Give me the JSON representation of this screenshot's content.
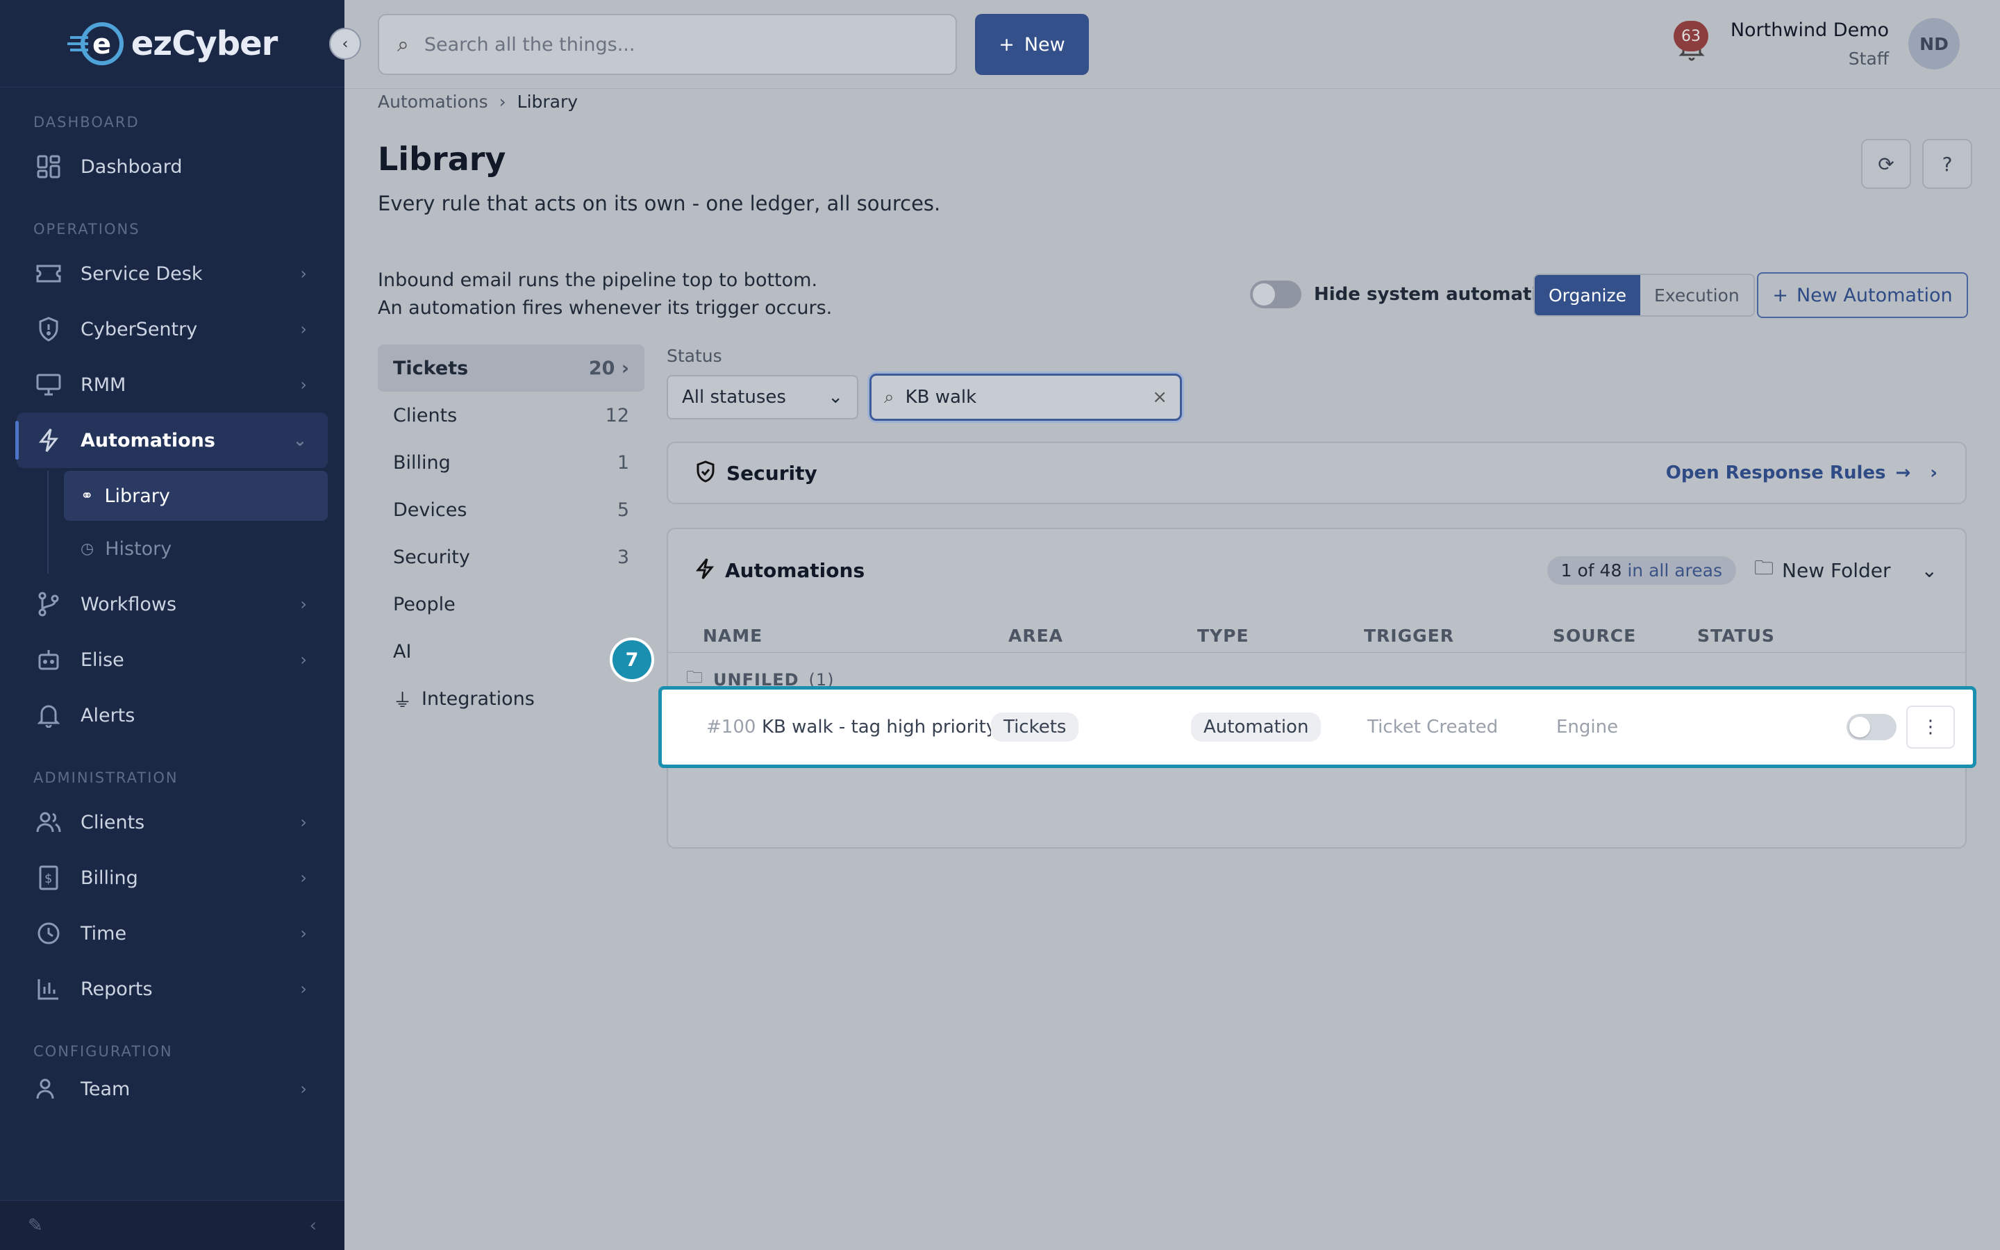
{
  "brand": {
    "name": "ezCyber"
  },
  "sidebar": {
    "sections": {
      "dashboard": "DASHBOARD",
      "operations": "OPERATIONS",
      "administration": "ADMINISTRATION",
      "configuration": "CONFIGURATION"
    },
    "items": {
      "dashboard": "Dashboard",
      "service_desk": "Service Desk",
      "cybersentry": "CyberSentry",
      "rmm": "RMM",
      "automations": "Automations",
      "library": "Library",
      "history": "History",
      "workflows": "Workflows",
      "elise": "Elise",
      "alerts": "Alerts",
      "clients": "Clients",
      "billing": "Billing",
      "time": "Time",
      "reports": "Reports",
      "team": "Team"
    }
  },
  "topbar": {
    "search_placeholder": "Search all the things...",
    "new_label": "New",
    "notification_count": "63",
    "user_name": "Northwind Demo",
    "user_role": "Staff",
    "avatar_initials": "ND"
  },
  "breadcrumb": {
    "parent": "Automations",
    "current": "Library"
  },
  "page": {
    "title": "Library",
    "subtitle": "Every rule that acts on its own - one ledger, all sources.",
    "intro_line1": "Inbound email runs the pipeline top to bottom.",
    "intro_line2": "An automation fires whenever its trigger occurs."
  },
  "controls": {
    "hide_system_label": "Hide system automations",
    "hide_system_on": false,
    "segment_organize": "Organize",
    "segment_execution": "Execution",
    "new_automation": "New Automation",
    "status_label": "Status",
    "status_value": "All statuses",
    "filter_value": "KB walk"
  },
  "areas": [
    {
      "label": "Tickets",
      "count": "20"
    },
    {
      "label": "Clients",
      "count": "12"
    },
    {
      "label": "Billing",
      "count": "1"
    },
    {
      "label": "Devices",
      "count": "5"
    },
    {
      "label": "Security",
      "count": "3"
    },
    {
      "label": "People",
      "count": ""
    },
    {
      "label": "AI",
      "count": ""
    },
    {
      "label": "Integrations",
      "count": ""
    }
  ],
  "security_card": {
    "title": "Security",
    "link": "Open Response Rules"
  },
  "automations_card": {
    "title": "Automations",
    "count_text": "1 of 48",
    "count_scope": "in all areas",
    "new_folder": "New Folder",
    "columns": {
      "name": "NAME",
      "area": "AREA",
      "type": "TYPE",
      "trigger": "TRIGGER",
      "source": "SOURCE",
      "status": "STATUS"
    },
    "unfiled_label": "UNFILED",
    "unfiled_count": "(1)",
    "rows": [
      {
        "id": "#100",
        "name": "KB walk - tag high priority VI",
        "area": "Tickets",
        "type": "Automation",
        "trigger": "Ticket Created",
        "source": "Engine",
        "enabled": false
      }
    ]
  },
  "tour": {
    "step": "7"
  }
}
